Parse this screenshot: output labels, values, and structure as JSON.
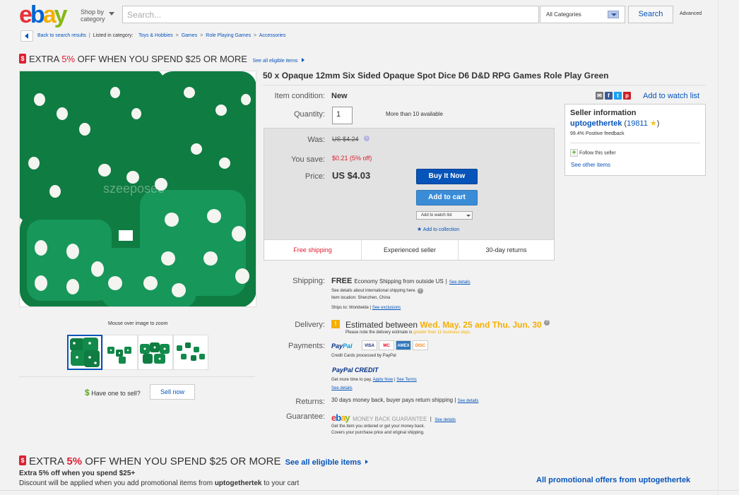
{
  "header": {
    "logo_letters": [
      "e",
      "b",
      "a",
      "y"
    ],
    "logo_colors": [
      "#e53238",
      "#0064d2",
      "#f5af02",
      "#86b817"
    ],
    "shop_by_line1": "Shop by",
    "shop_by_line2": "category",
    "search_placeholder": "Search...",
    "category_select": "All Categories",
    "search_button": "Search",
    "advanced": "Advanced"
  },
  "breadcrumb": {
    "back": "Back to search results",
    "listed_in": "Listed in category:",
    "items": [
      "Toys & Hobbies",
      "Games",
      "Role Playing Games",
      "Accessories"
    ]
  },
  "promo_top": {
    "icon": "$",
    "prefix": "EXTRA ",
    "percent": "5%",
    "suffix": " OFF WHEN YOU SPEND $25 OR MORE",
    "link": "See all eligible items"
  },
  "gallery": {
    "zoom_hint": "Mouse over image to zoom",
    "watermark": "szeeposee",
    "have_one": "Have one to sell?",
    "sell_now": "Sell now",
    "dice_color": "#128a4a"
  },
  "item": {
    "title": "50 x Opaque 12mm Six Sided Opaque Spot Dice D6 D&D RPG Games Role Play Green",
    "condition_label": "Item condition:",
    "condition_value": "New",
    "quantity_label": "Quantity:",
    "quantity_value": "1",
    "availability": "More than 10 available",
    "add_to_watch": "Add to watch list"
  },
  "price": {
    "was_label": "Was:",
    "was_value": "US $4.24",
    "save_label": "You save:",
    "save_value": "$0.21 (5% off)",
    "price_label": "Price:",
    "price_value": "US $4.03",
    "buy_now": "Buy It Now",
    "add_to_cart": "Add to cart",
    "watch_select": "Add to watch list",
    "add_collection": "Add to collection",
    "features": [
      "Free shipping",
      "Experienced seller",
      "30-day returns"
    ]
  },
  "seller": {
    "heading": "Seller information",
    "name": "uptogethertek",
    "feedback_count": "19811",
    "positive": "99.4%",
    "positive_label": "Positive feedback",
    "follow": "Follow this seller",
    "other_items": "See other items"
  },
  "shipping": {
    "label": "Shipping:",
    "free": "FREE",
    "method": "Economy Shipping from outside US",
    "see_details": "See details",
    "intl_note": "See details about international shipping here.",
    "item_location": "Item location: Shenzhen, China",
    "ships_to": "Ships to: Worldwide",
    "see_exclusions": "See exclusions"
  },
  "delivery": {
    "label": "Delivery:",
    "estimated": "Estimated between",
    "dates": "Wed. May. 25 and Thu. Jun. 30",
    "note_prefix": "Please note the delivery estimate is ",
    "note_highlight": "greater than 11 business days."
  },
  "payments": {
    "label": "Payments:",
    "paypal": "Pay",
    "paypal2": "Pal",
    "cards": [
      "VISA",
      "MC",
      "AMEX",
      "DISC"
    ],
    "processed": "Credit Cards processed by PayPal",
    "credit": "PayPal CREDIT",
    "get_more_time": "Get more time to pay.",
    "apply_now": "Apply Now",
    "see_terms": "See Terms",
    "see_details": "See details"
  },
  "returns": {
    "label": "Returns:",
    "value": "30 days money back, buyer pays return shipping",
    "see_details": "See details"
  },
  "guarantee": {
    "label": "Guarantee:",
    "badge": "MONEY BACK GUARANTEE",
    "see_details": "See details",
    "line1": "Get the item you ordered or get your money back.",
    "line2": "Covers your purchase price and original shipping."
  },
  "promo_bottom": {
    "icon": "$",
    "prefix": "EXTRA ",
    "percent": "5%",
    "suffix": " OFF WHEN YOU SPEND $25 OR MORE",
    "link": "See all eligible items",
    "sub_heading": "Extra 5% off when you spend $25+",
    "discount_prefix": "Discount will be applied when you add promotional items from ",
    "discount_seller": "uptogethertek",
    "discount_suffix": " to your cart",
    "all_offers": "All promotional offers from uptogethertek"
  }
}
